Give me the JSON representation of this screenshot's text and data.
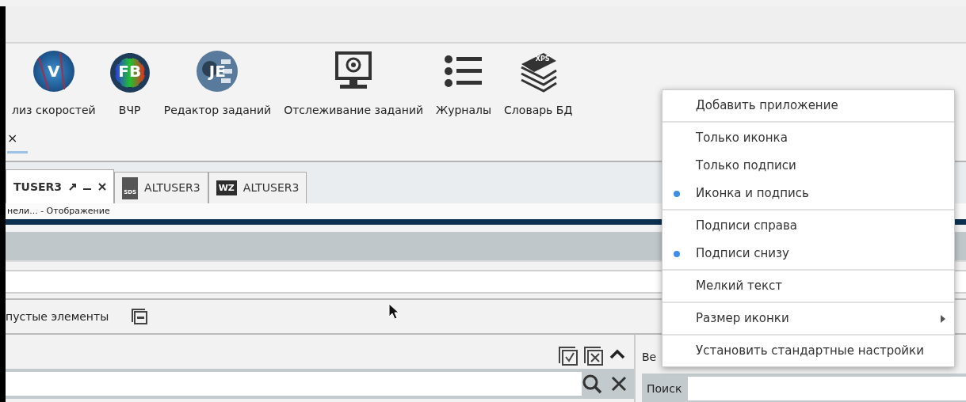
{
  "toolbar": {
    "apps": [
      {
        "label": "лиз скоростей",
        "icon_text": "V"
      },
      {
        "label": "ВЧР",
        "icon_text": "FB"
      },
      {
        "label": "Редактор заданий",
        "icon_text": "JE"
      },
      {
        "label": "Отслеживание заданий"
      },
      {
        "label": "Журналы"
      },
      {
        "label": "Словарь БД",
        "icon_text": "XPS"
      }
    ],
    "close_glyph": "×"
  },
  "tabs": [
    {
      "label": "TUSER3",
      "selected": true
    },
    {
      "label": "ALTUSER3",
      "selected": false,
      "icon_text": "SDS"
    },
    {
      "label": "ALTUSER3",
      "selected": false,
      "icon_text": "WZ"
    }
  ],
  "tab_subtitle": "нели... - Отображение",
  "filter_label": "пустые элементы",
  "right_panel": {
    "label": "Ве",
    "search_label": "Поиск"
  },
  "context_menu": {
    "groups": [
      [
        {
          "label": "Добавить приложение",
          "kind": "action"
        }
      ],
      [
        {
          "label": "Только иконка",
          "kind": "radio",
          "selected": false
        },
        {
          "label": "Только подписи",
          "kind": "radio",
          "selected": false
        },
        {
          "label": "Иконка и подпись",
          "kind": "radio",
          "selected": true
        }
      ],
      [
        {
          "label": "Подписи справа",
          "kind": "radio",
          "selected": false
        },
        {
          "label": "Подписи снизу",
          "kind": "radio",
          "selected": true
        }
      ],
      [
        {
          "label": "Мелкий текст",
          "kind": "action"
        }
      ],
      [
        {
          "label": "Размер иконки",
          "kind": "submenu"
        }
      ],
      [
        {
          "label": "Установить стандартные настройки",
          "kind": "action"
        }
      ]
    ]
  }
}
